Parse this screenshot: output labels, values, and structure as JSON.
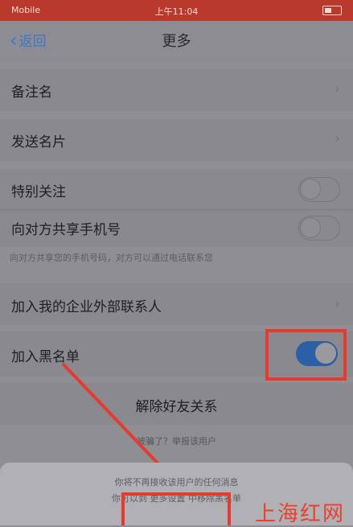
{
  "status": {
    "carrier": "Mobile",
    "time": "上午11:04"
  },
  "nav": {
    "back_label": "返回",
    "title": "更多"
  },
  "cells": {
    "remark": "备注名",
    "send_card": "发送名片",
    "special_follow": "特别关注",
    "share_phone": "向对方共享手机号",
    "share_phone_note": "向对方共享您的手机号码，对方可以通过电话联系您",
    "enterprise_contacts": "加入我的企业外部联系人",
    "blacklist": "加入黑名单"
  },
  "toggles": {
    "special_follow": false,
    "share_phone": false,
    "blacklist": true
  },
  "actions": {
    "remove_friend": "解除好友关系",
    "report": "被骗了？举报该用户"
  },
  "sheet": {
    "line1": "你将不再接收该用户的任何消息",
    "line2": "你可以到 更多设置 中移除黑名单"
  },
  "watermark": "上海红网",
  "colors": {
    "highlight": "#e63a2f",
    "link": "#3b78c8",
    "toggle_on": "#2d5fa6"
  }
}
